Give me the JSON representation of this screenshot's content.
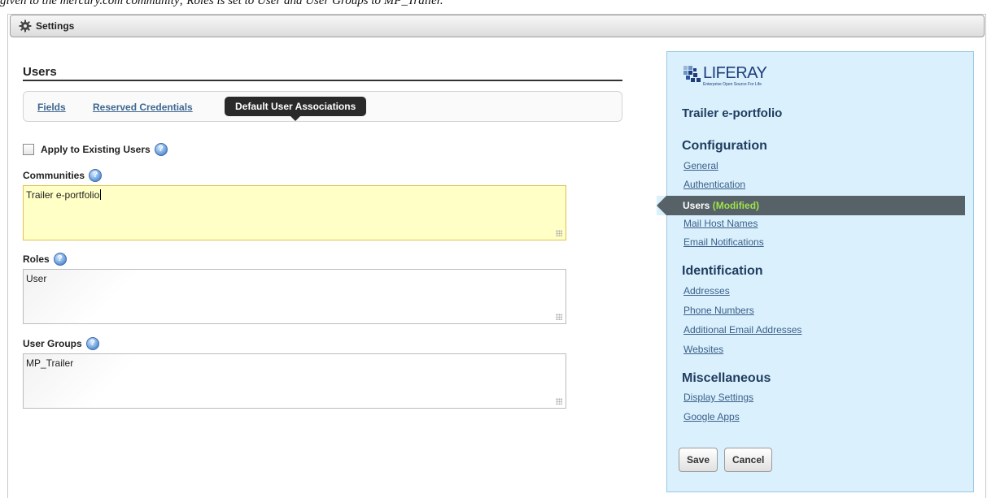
{
  "caption": "given to the mercury.com community; Roles is set to User and User Groups to MP_Trailer.",
  "settings_bar": {
    "title": "Settings",
    "icon": "gear-icon"
  },
  "section": {
    "heading": "Users"
  },
  "tabs": [
    {
      "label": "Fields"
    },
    {
      "label": "Reserved Credentials"
    },
    {
      "label": "Default User Associations"
    }
  ],
  "form": {
    "apply_existing": {
      "label": "Apply to Existing Users",
      "checked": false
    },
    "communities": {
      "label": "Communities",
      "value": "Trailer e-portfolio"
    },
    "roles": {
      "label": "Roles",
      "value": "User"
    },
    "user_groups": {
      "label": "User Groups",
      "value": "MP_Trailer"
    },
    "help_glyph": "?"
  },
  "panel": {
    "logo_text": "LIFERAY",
    "logo_tagline": "Enterprise Open Source For Life",
    "site_name": "Trailer e-portfolio",
    "sections": {
      "configuration": "Configuration",
      "identification": "Identification",
      "miscellaneous": "Miscellaneous"
    },
    "configuration_items": {
      "general": "General",
      "authentication": "Authentication",
      "users": "Users",
      "users_status": "(Modified)",
      "mail_host_names": "Mail Host Names",
      "email_notifications": "Email Notifications"
    },
    "identification_items": {
      "addresses": "Addresses",
      "phone_numbers": "Phone Numbers",
      "additional_email": "Additional Email Addresses",
      "websites": "Websites"
    },
    "misc_items": {
      "display_settings": "Display Settings",
      "google_apps": "Google Apps"
    },
    "buttons": {
      "save": "Save",
      "cancel": "Cancel"
    }
  },
  "colors": {
    "panel_bg": "#daf0fd",
    "link": "#3a5f88",
    "active_tab": "#2a2a2a",
    "modified": "#9fe24a",
    "active_field": "#ffffc6"
  }
}
